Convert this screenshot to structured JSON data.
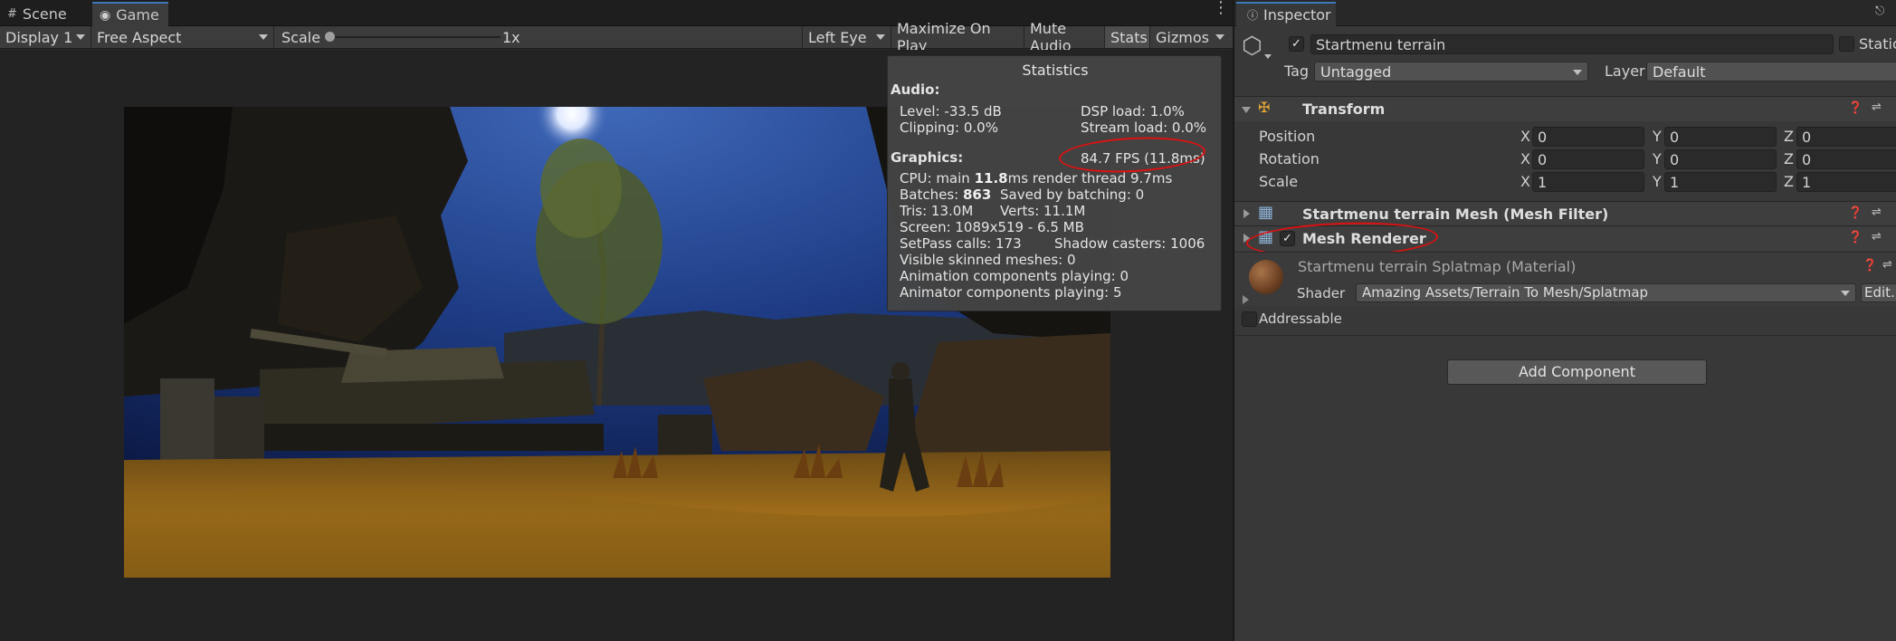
{
  "left_tabs": {
    "scene": "Scene",
    "game": "Game"
  },
  "toolbar": {
    "display": "Display 1",
    "aspect": "Free Aspect",
    "scale_label": "Scale",
    "scale_value": "1x",
    "scale_fraction": 0.0,
    "eye": "Left Eye",
    "maximize": "Maximize On Play",
    "mute": "Mute Audio",
    "stats": "Stats",
    "gizmos": "Gizmos"
  },
  "stats": {
    "title": "Statistics",
    "audio_header": "Audio:",
    "level": "Level: -33.5 dB",
    "clipping": "Clipping: 0.0%",
    "dsp": "DSP load: 1.0%",
    "stream": "Stream load: 0.0%",
    "graphics_header": "Graphics:",
    "fps": "84.7 FPS (11.8ms)",
    "cpu_prefix": "CPU: main ",
    "cpu_main": "11.8",
    "cpu_suffix": "ms  render thread 9.7ms",
    "batches_prefix": "Batches: ",
    "batches_value": "863",
    "saved": "Saved by batching: 0",
    "tris": "Tris: 13.0M",
    "verts": "Verts: 11.1M",
    "screen": "Screen: 1089x519 - 6.5 MB",
    "setpass": "SetPass calls: 173",
    "shadow": "Shadow casters: 1006",
    "skinned": "Visible skinned meshes: 0",
    "anim": "Animation components playing: 0",
    "animator": "Animator components playing: 5"
  },
  "inspector": {
    "tab": "Inspector",
    "object_name": "Startmenu terrain",
    "static": "Static",
    "tag_label": "Tag",
    "tag_value": "Untagged",
    "layer_label": "Layer",
    "layer_value": "Default",
    "transform": {
      "title": "Transform",
      "rows": [
        {
          "label": "Position",
          "x": "0",
          "y": "0",
          "z": "0"
        },
        {
          "label": "Rotation",
          "x": "0",
          "y": "0",
          "z": "0"
        },
        {
          "label": "Scale",
          "x": "1",
          "y": "1",
          "z": "1"
        }
      ],
      "axis_x": "X",
      "axis_y": "Y",
      "axis_z": "Z"
    },
    "mesh_filter": "Startmenu terrain Mesh (Mesh Filter)",
    "mesh_renderer": "Mesh Renderer",
    "material": "Startmenu terrain Splatmap (Material)",
    "shader_label": "Shader",
    "shader_value": "Amazing Assets/Terrain To Mesh/Splatmap",
    "edit": "Edit...",
    "addressable": "Addressable",
    "add_component": "Add Component"
  },
  "colors": {
    "accent": "#3a79bb",
    "annotation": "#e01010"
  }
}
